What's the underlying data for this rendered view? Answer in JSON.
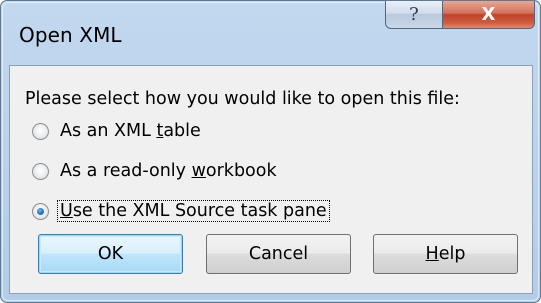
{
  "window": {
    "title": "Open XML",
    "help_glyph": "?",
    "close_glyph": "X"
  },
  "dialog": {
    "prompt": "Please select how you would like to open this file:",
    "options": [
      {
        "before": "As an XML ",
        "mnemonic": "t",
        "after": "able",
        "selected": false
      },
      {
        "before": "As a read-only ",
        "mnemonic": "w",
        "after": "orkbook",
        "selected": false
      },
      {
        "before": "",
        "mnemonic": "U",
        "after": "se the XML Source task pane",
        "selected": true
      }
    ]
  },
  "buttons": {
    "ok_label": "OK",
    "cancel_label": "Cancel",
    "help_mnemonic": "H",
    "help_rest": "elp"
  },
  "colors": {
    "frame": "#bdd4ed",
    "client": "#f0f0f0",
    "close_button": "#c0432a",
    "default_button_border": "#3c7fb1",
    "radio_selected": "#1d6bc4"
  }
}
